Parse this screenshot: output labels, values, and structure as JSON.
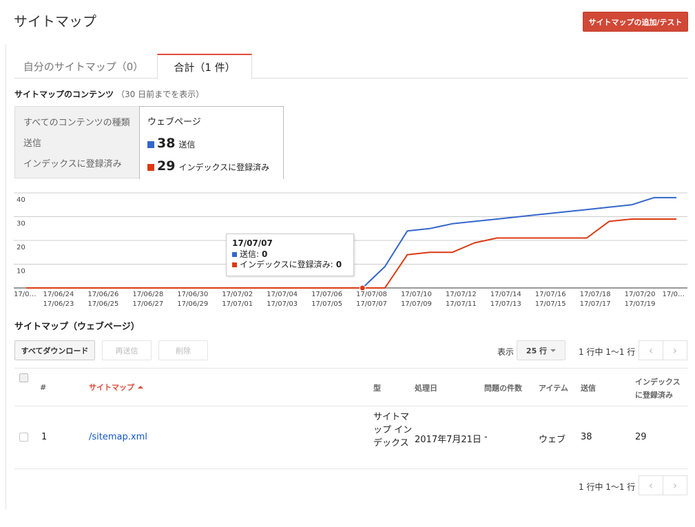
{
  "header": {
    "title": "サイトマップ",
    "add_button": "サイトマップの追加/テスト"
  },
  "tabs": [
    {
      "label": "自分のサイトマップ（0）",
      "active": false
    },
    {
      "label": "合計（1 件）",
      "active": true
    }
  ],
  "contents": {
    "heading": "サイトマップのコンテンツ",
    "sub": "（30 日前までを表示）",
    "picker": [
      "すべてのコンテンツの種類",
      "送信",
      "インデックスに登録済み"
    ],
    "panel_title": "ウェブページ",
    "stats": [
      {
        "value": "38",
        "label": "送信",
        "color": "#3366cc"
      },
      {
        "value": "29",
        "label": "インデックスに登録済み",
        "color": "#dc3912"
      }
    ]
  },
  "tooltip": {
    "date": "17/07/07",
    "rows": [
      {
        "label": "送信:",
        "value": "0",
        "color": "#3366cc"
      },
      {
        "label": "インデックスに登録済み:",
        "value": "0",
        "color": "#dc3912"
      }
    ]
  },
  "chart_data": {
    "type": "line",
    "ylim": [
      0,
      40
    ],
    "yticks": [
      "40",
      "30",
      "20",
      "10"
    ],
    "x_labels_top": [
      "17/0…",
      "17/06/24",
      "17/06/26",
      "17/06/28",
      "17/06/30",
      "17/07/02",
      "17/07/04",
      "17/07/06",
      "17/07/08",
      "17/07/10",
      "17/07/12",
      "17/07/14",
      "17/07/16",
      "17/07/18",
      "17/07/20",
      "17/0…"
    ],
    "x_labels_bottom": [
      "17/06/23",
      "17/06/25",
      "17/06/27",
      "17/06/29",
      "17/07/01",
      "17/07/03",
      "17/07/05",
      "17/07/07",
      "17/07/09",
      "17/07/11",
      "17/07/13",
      "17/07/15",
      "17/07/17",
      "17/07/19"
    ],
    "x": [
      "17/06/22",
      "17/06/23",
      "17/06/24",
      "17/06/25",
      "17/06/26",
      "17/06/27",
      "17/06/28",
      "17/06/29",
      "17/06/30",
      "17/07/01",
      "17/07/02",
      "17/07/03",
      "17/07/04",
      "17/07/05",
      "17/07/06",
      "17/07/07",
      "17/07/08",
      "17/07/09",
      "17/07/10",
      "17/07/11",
      "17/07/12",
      "17/07/13",
      "17/07/14",
      "17/07/15",
      "17/07/16",
      "17/07/17",
      "17/07/18",
      "17/07/19",
      "17/07/20",
      "17/07/21"
    ],
    "series": [
      {
        "name": "送信",
        "color": "#3366cc",
        "values": [
          0,
          0,
          0,
          0,
          0,
          0,
          0,
          0,
          0,
          0,
          0,
          0,
          0,
          0,
          0,
          0,
          9,
          24,
          25,
          27,
          28,
          29,
          30,
          31,
          32,
          33,
          34,
          35,
          38,
          38
        ]
      },
      {
        "name": "インデックスに登録済み",
        "color": "#dc3912",
        "values": [
          0,
          0,
          0,
          0,
          0,
          0,
          0,
          0,
          0,
          0,
          0,
          0,
          0,
          0,
          0,
          0,
          0,
          14,
          15,
          15,
          19,
          21,
          21,
          21,
          21,
          21,
          28,
          29,
          29,
          29
        ]
      }
    ],
    "highlight": "17/07/07"
  },
  "table": {
    "heading": "サイトマップ（ウェブページ）",
    "download": "すべてダウンロード",
    "resend": "再送信",
    "delete": "削除",
    "show_label": "表示",
    "rows_per_page": "25 行",
    "pagination": "1 行中 1～1 行",
    "columns": {
      "num": "#",
      "sitemap": "サイトマップ",
      "type": "型",
      "processed": "処理日",
      "issues": "問題の件数",
      "items": "アイテム",
      "submitted": "送信",
      "indexed_line1": "インデックス",
      "indexed_line2": "に登録済み"
    },
    "rows": [
      {
        "num": "1",
        "sitemap": "/sitemap.xml",
        "type": "サイトマップ インデックス",
        "processed": "2017年7月21日",
        "issues": "-",
        "items": "ウェブ",
        "submitted": "38",
        "indexed": "29"
      }
    ]
  }
}
